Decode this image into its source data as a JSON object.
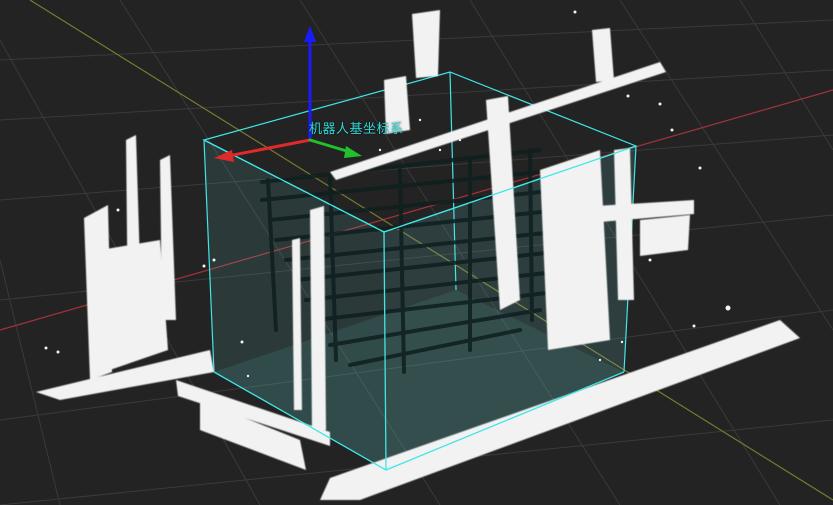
{
  "viewport": {
    "background": "#232323",
    "grid_color": "#3a3a3a",
    "grid_axis_x_color": "#a3333a",
    "grid_axis_y_color": "#7a7a2e"
  },
  "robot_base_frame": {
    "label": "机器人基坐标系",
    "label_color": "#2fd6d6",
    "axis_x_color": "#e02a2a",
    "axis_y_color": "#22c02a",
    "axis_z_color": "#1a1aff"
  },
  "workspace_box": {
    "edge_color": "#40e6e6",
    "fill_color": "#6fe0e0"
  },
  "point_cloud": {
    "color": "#f2f2f2",
    "dark_points_color": "#0e1f1f"
  }
}
